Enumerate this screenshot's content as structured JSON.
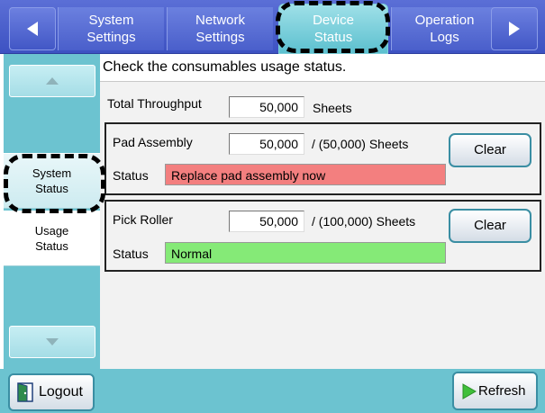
{
  "tabs": [
    {
      "line1": "System",
      "line2": "Settings"
    },
    {
      "line1": "Network",
      "line2": "Settings"
    },
    {
      "line1": "Device",
      "line2": "Status"
    },
    {
      "line1": "Operation",
      "line2": "Logs"
    }
  ],
  "sidebar": {
    "items": [
      {
        "line1": "System",
        "line2": "Status"
      },
      {
        "line1": "Usage",
        "line2": "Status"
      }
    ]
  },
  "main": {
    "instruction": "Check the consumables usage status.",
    "total": {
      "label": "Total Throughput",
      "value": "50,000",
      "unit": "Sheets"
    },
    "pad": {
      "name": "Pad Assembly",
      "value": "50,000",
      "limit": "/ (50,000) Sheets",
      "status_label": "Status",
      "status": "Replace pad assembly now",
      "clear_label": "Clear"
    },
    "roller": {
      "name": "Pick Roller",
      "value": "50,000",
      "limit": "/ (100,000) Sheets",
      "status_label": "Status",
      "status": "Normal",
      "clear_label": "Clear"
    }
  },
  "footer": {
    "logout_label": "Logout",
    "refresh_label": "Refresh"
  },
  "colors": {
    "tab_bar": "#4a5fcb",
    "active_tab": "#5cc0cf",
    "sidebar": "#6cc3d0",
    "status_error": "#f37f7f",
    "status_normal": "#85ea77"
  }
}
